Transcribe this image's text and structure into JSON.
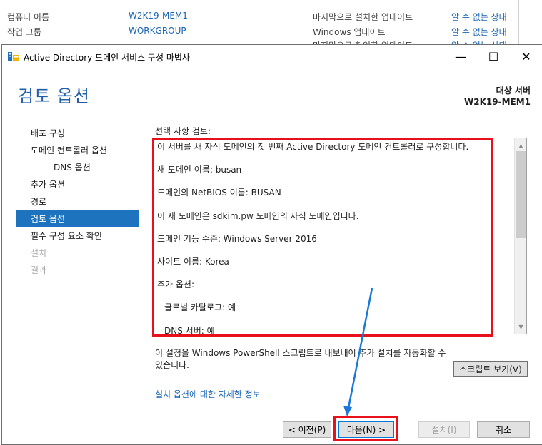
{
  "background": {
    "rows": [
      {
        "label": "컴퓨터 이름",
        "value": "W2K19-MEM1",
        "label2": "마지막으로 설치한 업데이트",
        "value2": "알 수 없는 상태"
      },
      {
        "label": "작업 그룹",
        "value": "WORKGROUP",
        "label2": "Windows 업데이트",
        "value2": "알 수 없는 상태"
      }
    ],
    "clipped_label": "마지막으로 확인한 업데이트",
    "clipped_value": "알 수 없는 상태"
  },
  "window": {
    "title": "Active Directory 도메인 서비스 구성 마법사",
    "controls": {
      "minimize": "—",
      "maximize": "☐",
      "close": "✕"
    }
  },
  "page": {
    "title": "검토 옵션",
    "target_label": "대상 서버",
    "target_server": "W2K19-MEM1"
  },
  "nav": {
    "items": [
      {
        "label": "배포 구성"
      },
      {
        "label": "도메인 컨트롤러 옵션"
      },
      {
        "label": "DNS 옵션"
      },
      {
        "label": "추가 옵션"
      },
      {
        "label": "경로"
      },
      {
        "label": "검토 옵션"
      },
      {
        "label": "필수 구성 요소 확인"
      },
      {
        "label": "설치"
      },
      {
        "label": "결과"
      }
    ]
  },
  "review": {
    "label": "선택 사항 검토:",
    "lines": [
      "이 서버를 새 자식 도메인의 첫 번째 Active Directory 도메인 컨트롤러로 구성합니다.",
      "새 도메인 이름: busan",
      "도메인의 NetBIOS 이름: BUSAN",
      "이 새 도메인은 sdkim.pw 도메인의 자식 도메인입니다.",
      "도메인 기능 수준: Windows Server 2016",
      "사이트 이름: Korea",
      "추가 옵션:",
      "글로벌 카탈로그: 예",
      "DNS 서버: 예"
    ]
  },
  "powershell_note": "이 설정을 Windows PowerShell 스크립트로 내보내어 추가 설치를 자동화할 수 있습니다.",
  "view_script_label": "스크립트 보기(V)",
  "more_info_link": "설치 옵션에 대한 자세한 정보",
  "buttons": {
    "previous": "< 이전(P)",
    "next": "다음(N) >",
    "install": "설치(I)",
    "cancel": "취소"
  },
  "colors": {
    "accent": "#1e73be",
    "title": "#1f5ea8",
    "link": "#1a64b4",
    "highlight": "#e8101a",
    "annotation_arrow": "#1a78d8"
  }
}
